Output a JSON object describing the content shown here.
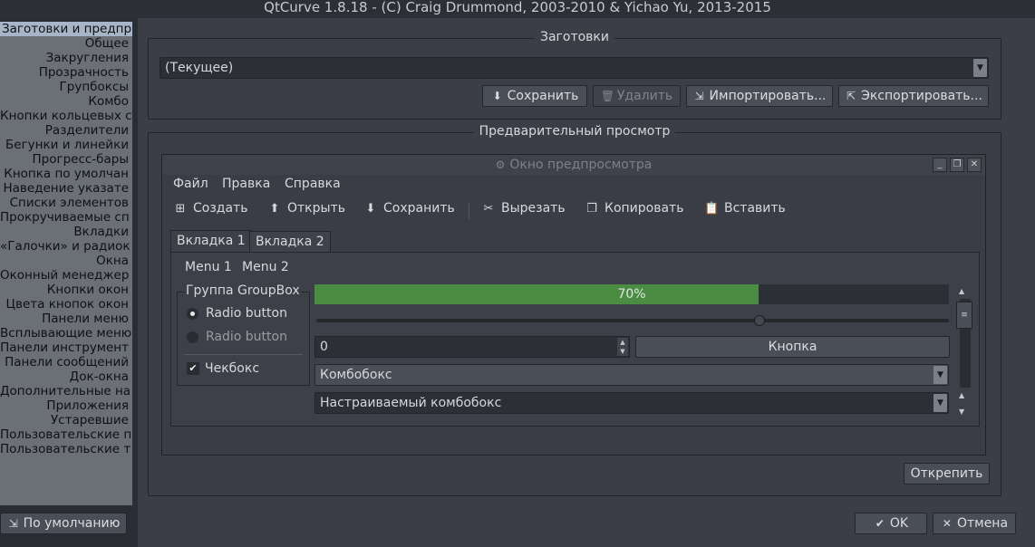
{
  "window": {
    "title": "QtCurve 1.8.18 - (C) Craig Drummond, 2003-2010 & Yichao Yu, 2013-2015"
  },
  "sidebar": {
    "items": [
      {
        "label": "Заготовки и предпр",
        "selected": true
      },
      {
        "label": "Общее"
      },
      {
        "label": "Закругления"
      },
      {
        "label": "Прозрачность"
      },
      {
        "label": "Групбоксы"
      },
      {
        "label": "Комбо"
      },
      {
        "label": "Кнопки кольцевых с"
      },
      {
        "label": "Разделители"
      },
      {
        "label": "Бегунки и линейки"
      },
      {
        "label": "Прогресс-бары"
      },
      {
        "label": "Кнопка по умолчан"
      },
      {
        "label": "Наведение указате"
      },
      {
        "label": "Списки элементов"
      },
      {
        "label": "Прокручиваемые сп"
      },
      {
        "label": "Вкладки"
      },
      {
        "label": "«Галочки» и радиок"
      },
      {
        "label": "Окна"
      },
      {
        "label": "Оконный менеджер"
      },
      {
        "label": "Кнопки окон"
      },
      {
        "label": "Цвета кнопок окон"
      },
      {
        "label": "Панели меню"
      },
      {
        "label": "Всплывающие меню"
      },
      {
        "label": "Панели инструмент"
      },
      {
        "label": "Панели сообщений"
      },
      {
        "label": "Док-окна"
      },
      {
        "label": "Дополнительные на"
      },
      {
        "label": "Приложения"
      },
      {
        "label": "Устаревшие"
      },
      {
        "label": "Пользовательские п"
      },
      {
        "label": "Пользовательские т"
      }
    ]
  },
  "presets": {
    "group_title": "Заготовки",
    "current": "(Текущее)",
    "save": "Сохранить",
    "delete": "Удалить",
    "import": "Импортировать...",
    "export": "Экспортировать..."
  },
  "preview": {
    "group_title": "Предварительный просмотр",
    "window_title": "Окно предпросмотра",
    "menu": [
      "Файл",
      "Правка",
      "Справка"
    ],
    "toolbar": {
      "create": "Создать",
      "open": "Открыть",
      "save": "Сохранить",
      "cut": "Вырезать",
      "copy": "Копировать",
      "paste": "Вставить"
    },
    "tabs": [
      "Вкладка 1",
      "Вкладка 2"
    ],
    "inner_menu": [
      "Menu 1",
      "Menu 2"
    ],
    "groupbox": {
      "title": "Группа GroupBox",
      "radio1": "Radio button",
      "radio2": "Radio button",
      "checkbox": "Чекбокс"
    },
    "progress": {
      "value": 0.7,
      "label": "70%"
    },
    "slider": {
      "value": 0.7
    },
    "spin_value": "0",
    "button": "Кнопка",
    "combo": "Комбобокс",
    "editable_combo": "Настраиваемый комбобокс",
    "detach": "Открепить"
  },
  "footer": {
    "defaults": "По умолчанию",
    "ok": "OK",
    "cancel": "Отмена"
  },
  "colors": {
    "progress_fill": "#4a8c42",
    "selection": "#a8b5c8"
  }
}
